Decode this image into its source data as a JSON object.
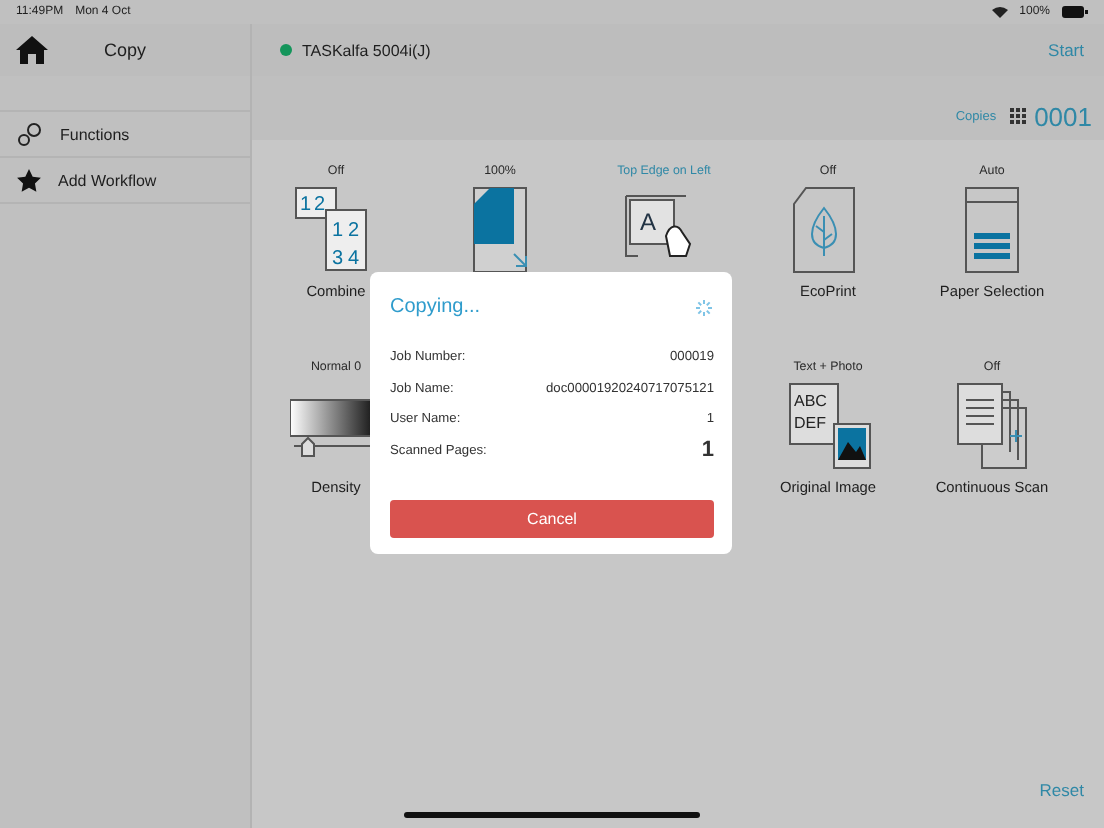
{
  "status_bar": {
    "time": "11:49PM",
    "date": "Mon 4 Oct",
    "battery": "100%"
  },
  "sidebar": {
    "title": "Copy",
    "items": [
      {
        "label": "Functions",
        "kind": "gear"
      },
      {
        "label": "Add Workflow",
        "kind": "star"
      }
    ]
  },
  "header": {
    "device": "TASKalfa 5004i(J)",
    "connected": true,
    "start": "Start"
  },
  "copies": {
    "label": "Copies",
    "value": "0001"
  },
  "functions": [
    [
      {
        "value": "Off",
        "label": "Combine",
        "kind": "combine",
        "highlighted": false,
        "icon_text": [
          "1",
          "2",
          "1",
          "2",
          "3",
          "4"
        ]
      },
      {
        "value": "100%",
        "kind": "zoom",
        "highlighted": false
      },
      {
        "value": "Top Edge on Left",
        "kind": "orientation",
        "highlighted": true,
        "icon_text": [
          "A"
        ]
      },
      {
        "value": "Off",
        "label": "EcoPrint",
        "kind": "eco",
        "highlighted": false
      },
      {
        "value": "Auto",
        "label": "Paper Selection",
        "kind": "paper",
        "highlighted": false
      }
    ],
    [
      {
        "value": "Normal 0",
        "label": "Density",
        "kind": "density",
        "highlighted": false
      },
      {
        "value": "Text + Photo",
        "label": "Original Image",
        "kind": "original",
        "highlighted": false,
        "icon_text": [
          "ABC",
          "DEF"
        ]
      },
      {
        "value": "Off",
        "label": "Continuous Scan",
        "kind": "scan",
        "highlighted": false
      }
    ]
  ],
  "reset": "Reset",
  "dialog": {
    "title": "Copying...",
    "fields": [
      {
        "label": "Job Number:",
        "value": "000019",
        "emphasis": false
      },
      {
        "label": "Job Name:",
        "value": "doc00001920240717075121",
        "emphasis": false
      },
      {
        "label": "User Name:",
        "value": "1",
        "emphasis": false
      },
      {
        "label": "Scanned Pages:",
        "value": "1",
        "emphasis": true
      }
    ],
    "cancel": "Cancel"
  }
}
